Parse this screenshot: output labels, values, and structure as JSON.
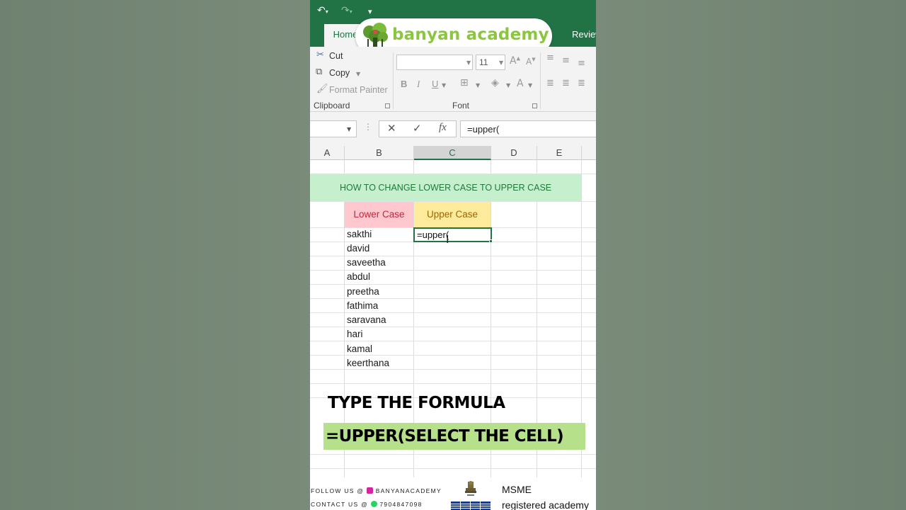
{
  "quick_access": {
    "undo_icon": "undo-icon",
    "redo_icon": "redo-icon",
    "customize_icon": "customize-icon"
  },
  "tabs": {
    "home": "Home",
    "review": "Review"
  },
  "logo": {
    "text": "banyan academy"
  },
  "ribbon": {
    "clipboard": {
      "cut": "Cut",
      "copy": "Copy",
      "format_painter": "Format Painter",
      "group_label": "Clipboard"
    },
    "font": {
      "size": "11",
      "group_label": "Font",
      "bold": "B",
      "italic": "I",
      "underline": "U"
    }
  },
  "formula_bar": {
    "cancel": "✕",
    "enter": "✓",
    "fx": "fx",
    "formula": "=upper("
  },
  "columns": [
    "A",
    "B",
    "C",
    "D",
    "E"
  ],
  "sheet": {
    "title": "HOW TO CHANGE LOWER CASE TO UPPER CASE",
    "header_lower": "Lower Case",
    "header_upper": "Upper Case",
    "names": [
      "sakthi",
      "david",
      "saveetha",
      "abdul",
      "preetha",
      "fathima",
      "saravana",
      "hari",
      "kamal",
      "keerthana"
    ],
    "active_cell_value": "=upper("
  },
  "caption": {
    "line1": "TYPE THE FORMULA",
    "line2": "=UPPER(SELECT THE CELL)"
  },
  "footer": {
    "follow_prefix": "FOLLOW US @",
    "handle": "BANYANACADEMY",
    "contact_prefix": "CONTACT US @",
    "phone": "7904847098",
    "msme": "MSME",
    "msme_sub": "registered academy"
  },
  "colors": {
    "excel_green": "#217346",
    "logo_green": "#8cc63f",
    "title_band": "#c6efce",
    "lower_header": "#ffc7ce",
    "upper_header": "#ffeb9c",
    "caption_band": "#b7e08a"
  }
}
